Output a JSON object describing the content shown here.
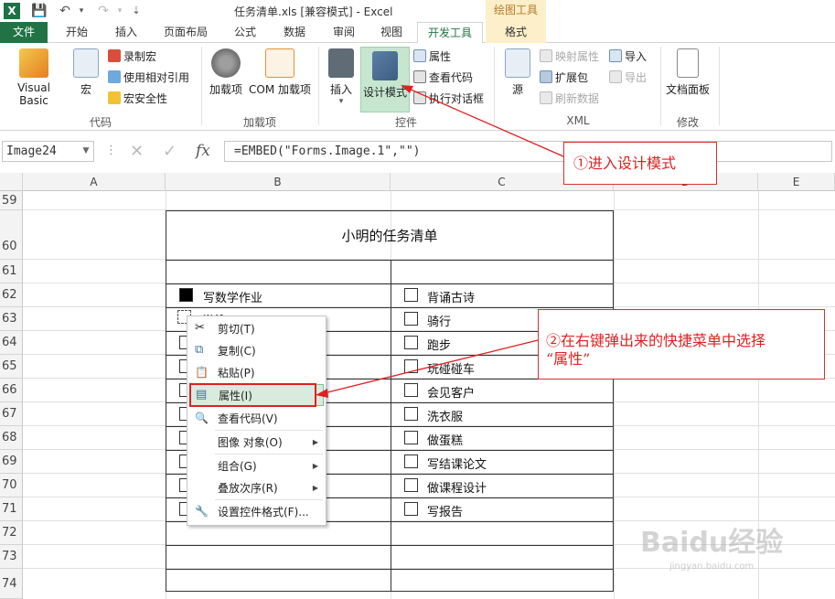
{
  "window": {
    "title": "任务清单.xls  [兼容模式] - Excel",
    "contextual_tab_header": "绘图工具",
    "app_icon": "X"
  },
  "qat": {
    "save_icon": "💾",
    "undo_icon": "↶",
    "redo_icon": "↷",
    "customize_icon": "⇣"
  },
  "tabs": [
    "文件",
    "开始",
    "插入",
    "页面布局",
    "公式",
    "数据",
    "审阅",
    "视图",
    "开发工具",
    "格式"
  ],
  "active_tab": "开发工具",
  "ribbon": {
    "code": {
      "label": "代码",
      "visual_basic": "Visual Basic",
      "macro": "宏",
      "record_macro": "录制宏",
      "relative_ref": "使用相对引用",
      "macro_security": "宏安全性"
    },
    "addins": {
      "label": "加载项",
      "addins": "加载项",
      "com_addins": "COM 加载项"
    },
    "controls": {
      "label": "控件",
      "insert": "插入",
      "insert_arrow": "▾",
      "design_mode": "设计模式",
      "properties": "属性",
      "view_code": "查看代码",
      "run_dialog": "执行对话框"
    },
    "xml": {
      "label": "XML",
      "source": "源",
      "map_properties": "映射属性",
      "expansion_packs": "扩展包",
      "refresh_data": "刷新数据",
      "import": "导入",
      "export": "导出"
    },
    "modify": {
      "label": "修改",
      "document_panel": "文档面板"
    }
  },
  "formula_bar": {
    "name_box": "Image24",
    "name_box_arrow": "▼",
    "dots": "⋮",
    "cancel_icon": "✕",
    "enter_icon": "✓",
    "fx": "fx",
    "formula": "=EMBED(\"Forms.Image.1\",\"\")"
  },
  "columns": [
    "A",
    "B",
    "C",
    "D",
    "E"
  ],
  "rows": [
    "59",
    "60",
    "61",
    "62",
    "63",
    "64",
    "65",
    "66",
    "67",
    "68",
    "69",
    "70",
    "71",
    "72",
    "73",
    "74"
  ],
  "task_table": {
    "title": "小明的任务清单",
    "left_first": "写数学作业",
    "left_first_partial": "游泳",
    "right": [
      "背诵古诗",
      "骑行",
      "跑步",
      "玩碰碰车",
      "会见客户",
      "洗衣服",
      "做蛋糕",
      "写结课论文",
      "做课程设计",
      "写报告"
    ]
  },
  "context_menu": {
    "items": [
      {
        "label": "剪切(T)",
        "icon": "✂",
        "submenu": false
      },
      {
        "label": "复制(C)",
        "icon": "⧉",
        "submenu": false
      },
      {
        "label": "粘贴(P)",
        "icon": "📋",
        "submenu": false
      },
      {
        "label": "属性(I)",
        "icon": "▤",
        "submenu": false,
        "highlighted": true
      },
      {
        "label": "查看代码(V)",
        "icon": "🔍",
        "submenu": false
      },
      {
        "label": "图像 对象(O)",
        "icon": "",
        "submenu": true
      },
      {
        "label": "组合(G)",
        "icon": "",
        "submenu": true
      },
      {
        "label": "叠放次序(R)",
        "icon": "",
        "submenu": true
      },
      {
        "label": "设置控件格式(F)...",
        "icon": "🔧",
        "submenu": false
      }
    ],
    "submenu_arrow": "▶"
  },
  "annotations": {
    "step1": "①进入设计模式",
    "step2_line1": "②在右键弹出来的快捷菜单中选择",
    "step2_line2": "“属性”",
    "color": "#e02020"
  },
  "watermark": {
    "brand": "Baidu经验",
    "url": "jingyan.baidu.com"
  },
  "colors": {
    "excel_green": "#217346",
    "accent_red": "#e02020",
    "format_tab_bg": "#fcefc9"
  }
}
